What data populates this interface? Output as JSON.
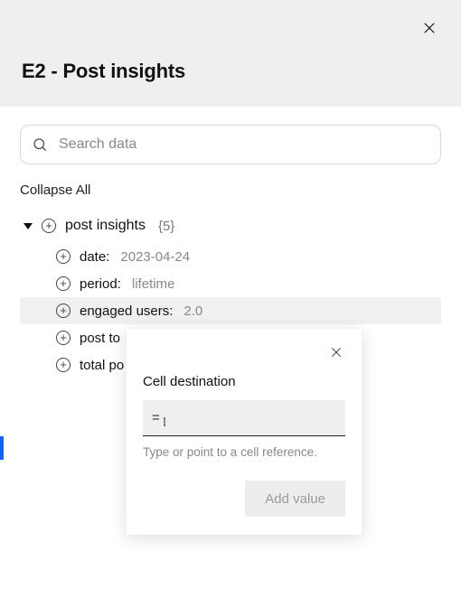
{
  "header": {
    "title": "E2 - Post insights"
  },
  "search": {
    "placeholder": "Search data",
    "value": ""
  },
  "collapse_label": "Collapse All",
  "tree": {
    "root_label": "post insights",
    "root_count": "{5}",
    "items": [
      {
        "key": "date",
        "value": "2023-04-24",
        "truncated": false,
        "highlight": false
      },
      {
        "key": "period",
        "value": "lifetime",
        "truncated": false,
        "highlight": false
      },
      {
        "key": "engaged users",
        "value": "2.0",
        "truncated": false,
        "highlight": true
      },
      {
        "key": "post to",
        "value": "",
        "truncated": true,
        "highlight": false
      },
      {
        "key": "total po",
        "value": "",
        "truncated": true,
        "highlight": false
      }
    ]
  },
  "popover": {
    "title": "Cell destination",
    "prefix": "=",
    "value": "",
    "hint": "Type or point to a cell reference.",
    "submit_label": "Add value"
  }
}
